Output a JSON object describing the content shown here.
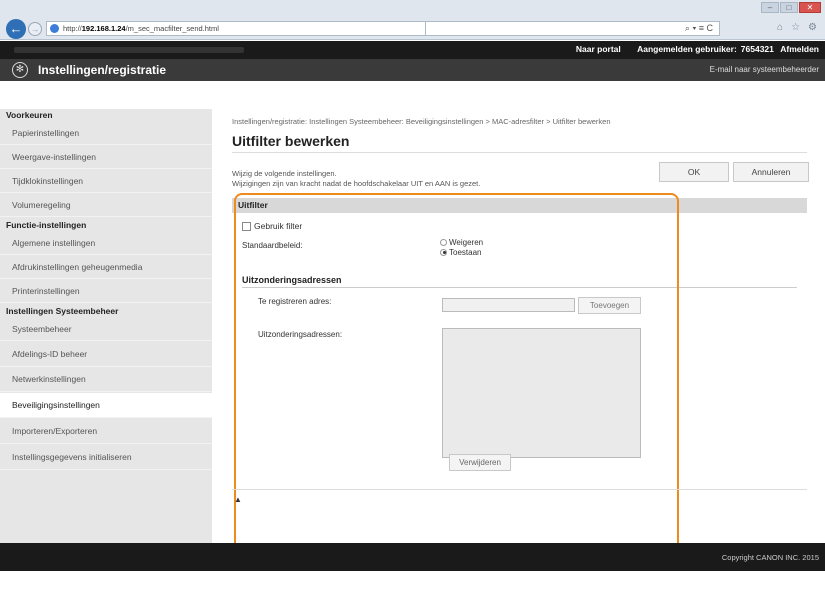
{
  "browser": {
    "url_prefix": "http://",
    "url_host": "192.168.1.24",
    "url_path": "/m_sec_macfilter_send.html",
    "search_icons": "⌕ ▾ ≡ C",
    "toolbar_icons": [
      "home-icon",
      "star-icon",
      "gear-icon"
    ]
  },
  "header": {
    "portal_link": "Naar portal",
    "logged_in_label": "Aangemelden gebruiker:",
    "user_id": "7654321",
    "logout": "Afmelden",
    "app_title": "Instellingen/registratie",
    "email_link": "E-mail naar systeembeheerder"
  },
  "sidebar": {
    "groups": [
      {
        "title": "Voorkeuren",
        "items": [
          "Papierinstellingen",
          "Weergave-instellingen",
          "Tijdklokinstellingen",
          "Volumeregeling"
        ]
      },
      {
        "title": "Functie-instellingen",
        "items": [
          "Algemene instellingen",
          "Afdrukinstellingen geheugenmedia",
          "Printerinstellingen"
        ]
      },
      {
        "title": "Instellingen Systeembeheer",
        "items": [
          "Systeembeheer",
          "Afdelings-ID beheer",
          "Netwerkinstellingen",
          "Beveiligingsinstellingen",
          "Importeren/Exporteren",
          "Instellingsgegevens initialiseren"
        ]
      }
    ],
    "active": "Beveiligingsinstellingen"
  },
  "main": {
    "breadcrumb": "Instellingen/registratie: Instellingen Systeembeheer: Beveiligingsinstellingen > MAC-adresfilter > Uitfilter bewerken",
    "title": "Uitfilter bewerken",
    "desc1": "Wijzig de volgende instellingen.",
    "desc2": "Wijzigingen zijn van kracht nadat de hoofdschakelaar UIT en AAN is gezet.",
    "ok_label": "OK",
    "cancel_label": "Annuleren",
    "section_title": "Uitfilter",
    "use_filter_label": "Gebruik filter",
    "use_filter_checked": false,
    "default_policy_label": "Standaardbeleid:",
    "policy_options": [
      "Weigeren",
      "Toestaan"
    ],
    "policy_selected": "Toestaan",
    "exceptions_heading": "Uitzonderingsadressen",
    "register_label": "Te registreren adres:",
    "register_value": "",
    "add_label": "Toevoegen",
    "list_label": "Uitzonderingsadressen:",
    "delete_label": "Verwijderen",
    "top_label": "▲"
  },
  "footer": {
    "copyright": "Copyright CANON INC. 2015"
  },
  "colors": {
    "highlight": "#ed8b1d",
    "header_dark": "#1a1a1a",
    "title_strip": "#3a3a3a",
    "sidebar_bg": "#e6e6e6"
  }
}
